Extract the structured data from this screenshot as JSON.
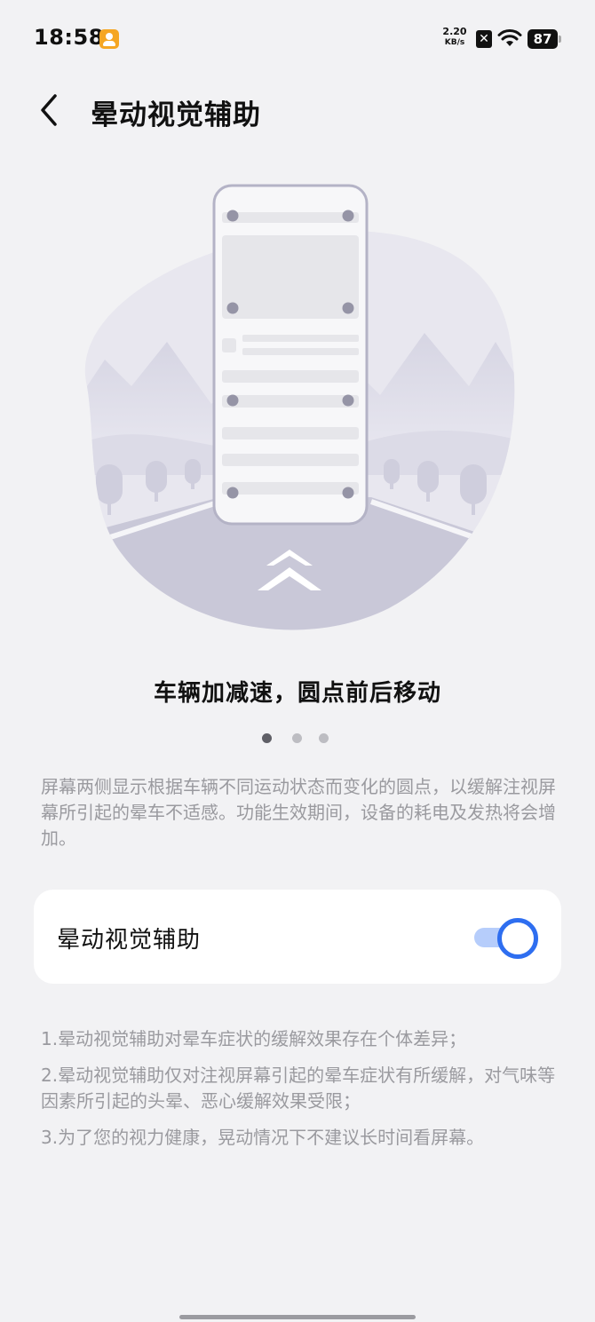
{
  "status": {
    "time": "18:58",
    "net_speed_value": "2.20",
    "net_speed_unit": "KB/s",
    "battery": "87"
  },
  "header": {
    "title": "晕动视觉辅助"
  },
  "carousel": {
    "caption": "车辆加减速，圆点前后移动",
    "page_count": 3,
    "active_index": 0
  },
  "description": "屏幕两侧显示根据车辆不同运动状态而变化的圆点，以缓解注视屏幕所引起的晕车不适感。功能生效期间，设备的耗电及发热将会增加。",
  "setting": {
    "label": "晕动视觉辅助",
    "enabled": true
  },
  "notes": [
    "1.晕动视觉辅助对晕车症状的缓解效果存在个体差异；",
    "2.晕动视觉辅助仅对注视屏幕引起的晕车症状有所缓解，对气味等因素所引起的头晕、恶心缓解效果受限；",
    "3.为了您的视力健康，晃动情况下不建议长时间看屏幕。"
  ],
  "colors": {
    "accent": "#2e6ef0",
    "background": "#f2f2f4"
  }
}
